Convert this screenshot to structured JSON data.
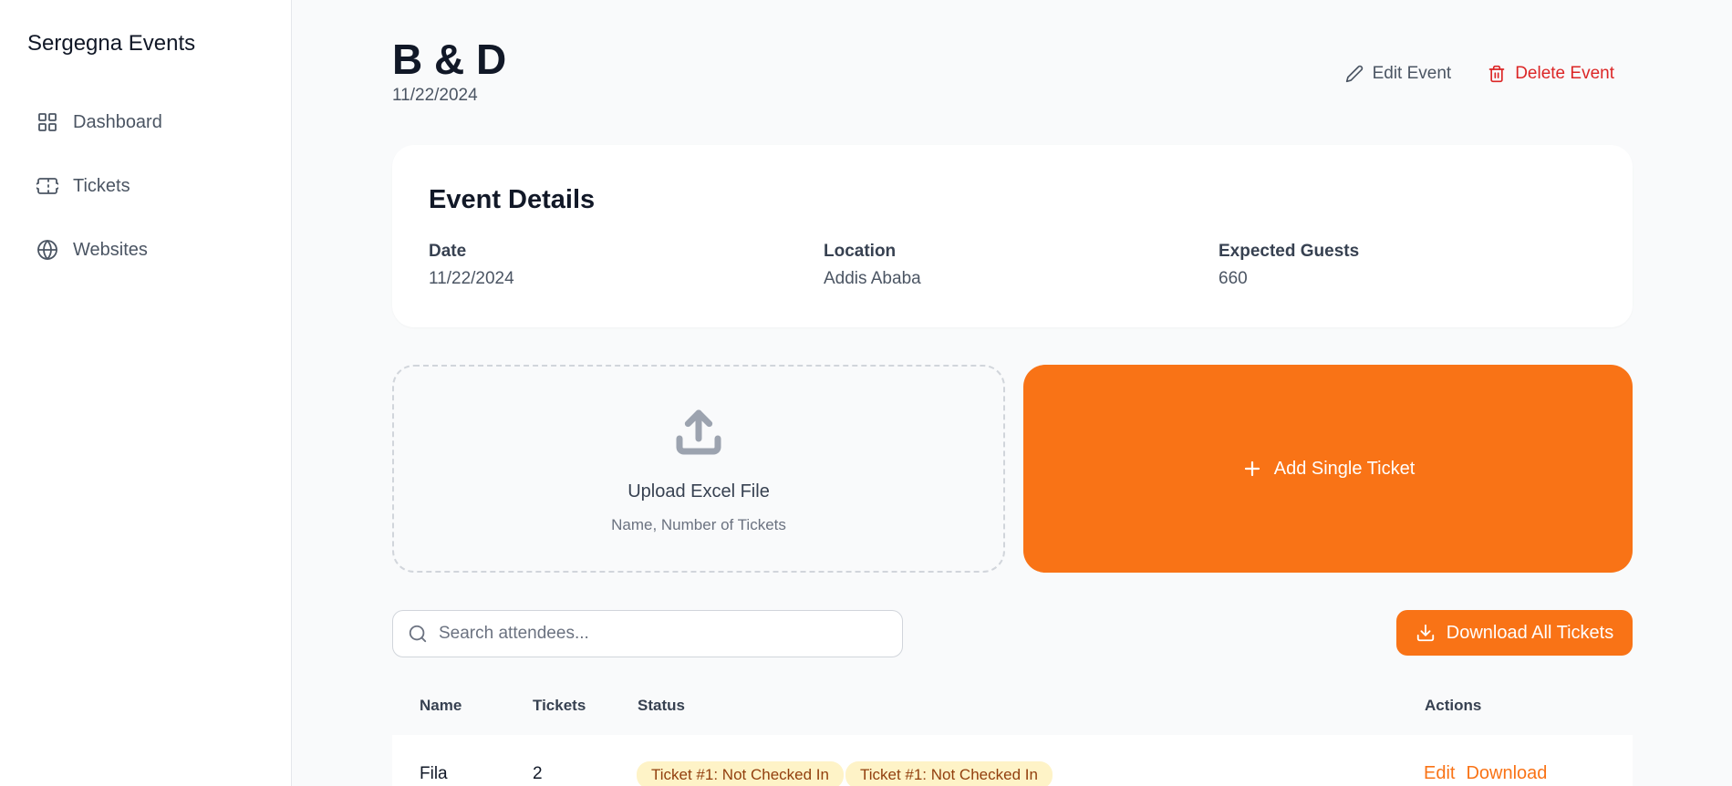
{
  "sidebar": {
    "brand": "Sergegna Events",
    "items": [
      {
        "label": "Dashboard",
        "icon": "grid-icon"
      },
      {
        "label": "Tickets",
        "icon": "ticket-icon"
      },
      {
        "label": "Websites",
        "icon": "globe-icon"
      }
    ]
  },
  "header": {
    "title": "B & D",
    "date": "11/22/2024",
    "edit_label": "Edit Event",
    "delete_label": "Delete Event"
  },
  "details": {
    "title": "Event Details",
    "date_label": "Date",
    "date_value": "11/22/2024",
    "location_label": "Location",
    "location_value": "Addis Ababa",
    "guests_label": "Expected Guests",
    "guests_value": "660"
  },
  "upload": {
    "title": "Upload Excel File",
    "subtitle": "Name, Number of Tickets"
  },
  "add_ticket": {
    "label": "Add Single Ticket"
  },
  "search": {
    "placeholder": "Search attendees..."
  },
  "download_all": {
    "label": "Download All Tickets"
  },
  "table": {
    "columns": [
      "Name",
      "Tickets",
      "Status",
      "Actions"
    ],
    "rows": [
      {
        "name": "Fila",
        "tickets": "2",
        "status": [
          "Ticket #1: Not Checked In",
          "Ticket #1: Not Checked In"
        ],
        "actions": [
          "Edit",
          "Download"
        ]
      }
    ]
  },
  "colors": {
    "accent": "#f97316",
    "danger": "#dc2626",
    "badge_bg": "#fef3c7",
    "badge_text": "#92400e"
  }
}
